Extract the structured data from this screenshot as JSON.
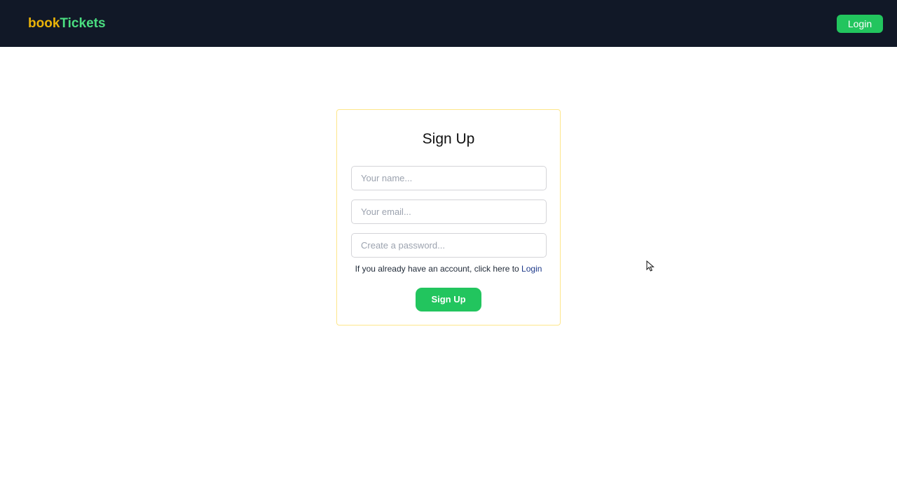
{
  "header": {
    "logo_part_1": "book",
    "logo_part_2": "Tickets",
    "login_label": "Login"
  },
  "form": {
    "title": "Sign Up",
    "name_placeholder": "Your name...",
    "email_placeholder": "Your email...",
    "password_placeholder": "Create a password...",
    "note_prefix": "If you already have an account, click here to ",
    "note_link": "Login",
    "submit_label": "Sign Up"
  },
  "colors": {
    "navbar_background": "#111827",
    "logo_book": "#eab308",
    "logo_tickets": "#4ade80",
    "primary_button": "#22c55e",
    "card_border": "#fde68a",
    "link": "#1e3a8a"
  },
  "icons": {
    "cursor": "mouse-pointer-icon"
  }
}
